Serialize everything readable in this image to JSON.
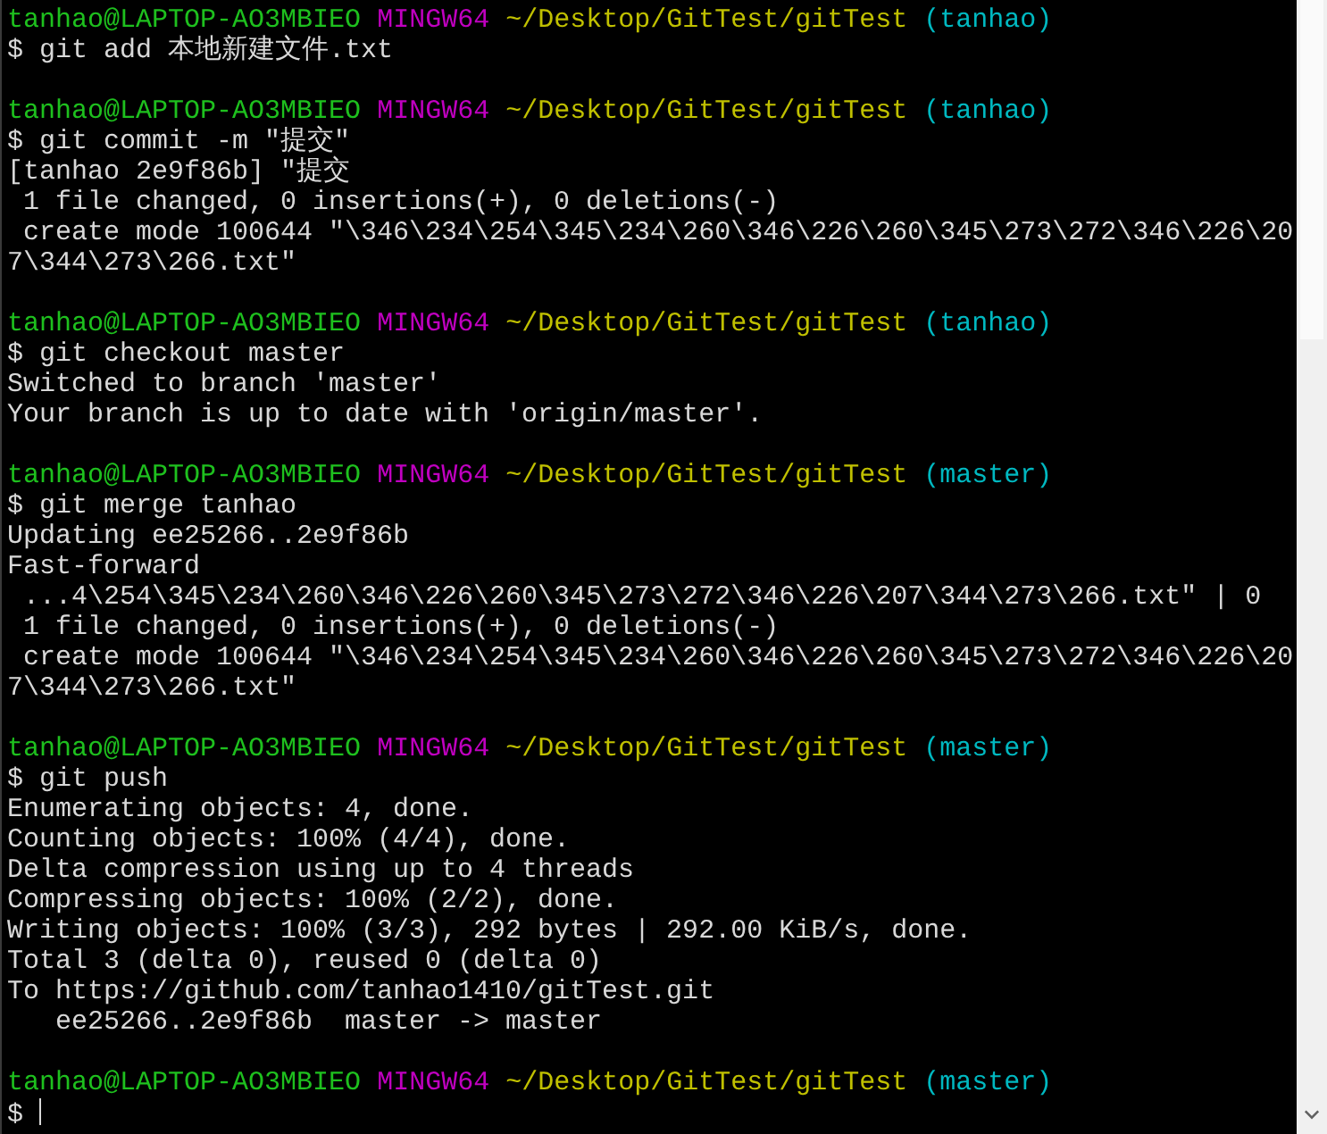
{
  "terminal": {
    "lines": [
      {
        "kind": "prompt",
        "user_host": "tanhao@LAPTOP-AO3MBIEO",
        "system": "MINGW64",
        "path": "~/Desktop/GitTest/gitTest",
        "branch": "(tanhao)"
      },
      {
        "kind": "command",
        "text": "$ git add 本地新建文件.txt"
      },
      {
        "kind": "blank"
      },
      {
        "kind": "prompt",
        "user_host": "tanhao@LAPTOP-AO3MBIEO",
        "system": "MINGW64",
        "path": "~/Desktop/GitTest/gitTest",
        "branch": "(tanhao)"
      },
      {
        "kind": "command",
        "text": "$ git commit -m \"提交\""
      },
      {
        "kind": "output",
        "text": "[tanhao 2e9f86b] \"提交"
      },
      {
        "kind": "output",
        "text": " 1 file changed, 0 insertions(+), 0 deletions(-)"
      },
      {
        "kind": "output",
        "text": " create mode 100644 \"\\346\\234\\254\\345\\234\\260\\346\\226\\260\\345\\273\\272\\346\\226\\20"
      },
      {
        "kind": "output",
        "text": "7\\344\\273\\266.txt\""
      },
      {
        "kind": "blank"
      },
      {
        "kind": "prompt",
        "user_host": "tanhao@LAPTOP-AO3MBIEO",
        "system": "MINGW64",
        "path": "~/Desktop/GitTest/gitTest",
        "branch": "(tanhao)"
      },
      {
        "kind": "command",
        "text": "$ git checkout master"
      },
      {
        "kind": "output",
        "text": "Switched to branch 'master'"
      },
      {
        "kind": "output",
        "text": "Your branch is up to date with 'origin/master'."
      },
      {
        "kind": "blank"
      },
      {
        "kind": "prompt",
        "user_host": "tanhao@LAPTOP-AO3MBIEO",
        "system": "MINGW64",
        "path": "~/Desktop/GitTest/gitTest",
        "branch": "(master)"
      },
      {
        "kind": "command",
        "text": "$ git merge tanhao"
      },
      {
        "kind": "output",
        "text": "Updating ee25266..2e9f86b"
      },
      {
        "kind": "output",
        "text": "Fast-forward"
      },
      {
        "kind": "output",
        "text": " ...4\\254\\345\\234\\260\\346\\226\\260\\345\\273\\272\\346\\226\\207\\344\\273\\266.txt\" | 0"
      },
      {
        "kind": "output",
        "text": " 1 file changed, 0 insertions(+), 0 deletions(-)"
      },
      {
        "kind": "output",
        "text": " create mode 100644 \"\\346\\234\\254\\345\\234\\260\\346\\226\\260\\345\\273\\272\\346\\226\\20"
      },
      {
        "kind": "output",
        "text": "7\\344\\273\\266.txt\""
      },
      {
        "kind": "blank"
      },
      {
        "kind": "prompt",
        "user_host": "tanhao@LAPTOP-AO3MBIEO",
        "system": "MINGW64",
        "path": "~/Desktop/GitTest/gitTest",
        "branch": "(master)"
      },
      {
        "kind": "command",
        "text": "$ git push"
      },
      {
        "kind": "output",
        "text": "Enumerating objects: 4, done."
      },
      {
        "kind": "output",
        "text": "Counting objects: 100% (4/4), done."
      },
      {
        "kind": "output",
        "text": "Delta compression using up to 4 threads"
      },
      {
        "kind": "output",
        "text": "Compressing objects: 100% (2/2), done."
      },
      {
        "kind": "output",
        "text": "Writing objects: 100% (3/3), 292 bytes | 292.00 KiB/s, done."
      },
      {
        "kind": "output",
        "text": "Total 3 (delta 0), reused 0 (delta 0)"
      },
      {
        "kind": "output",
        "text": "To https://github.com/tanhao1410/gitTest.git"
      },
      {
        "kind": "output",
        "text": "   ee25266..2e9f86b  master -> master"
      },
      {
        "kind": "blank"
      },
      {
        "kind": "prompt",
        "user_host": "tanhao@LAPTOP-AO3MBIEO",
        "system": "MINGW64",
        "path": "~/Desktop/GitTest/gitTest",
        "branch": "(master)"
      },
      {
        "kind": "input",
        "text": "$"
      }
    ]
  }
}
